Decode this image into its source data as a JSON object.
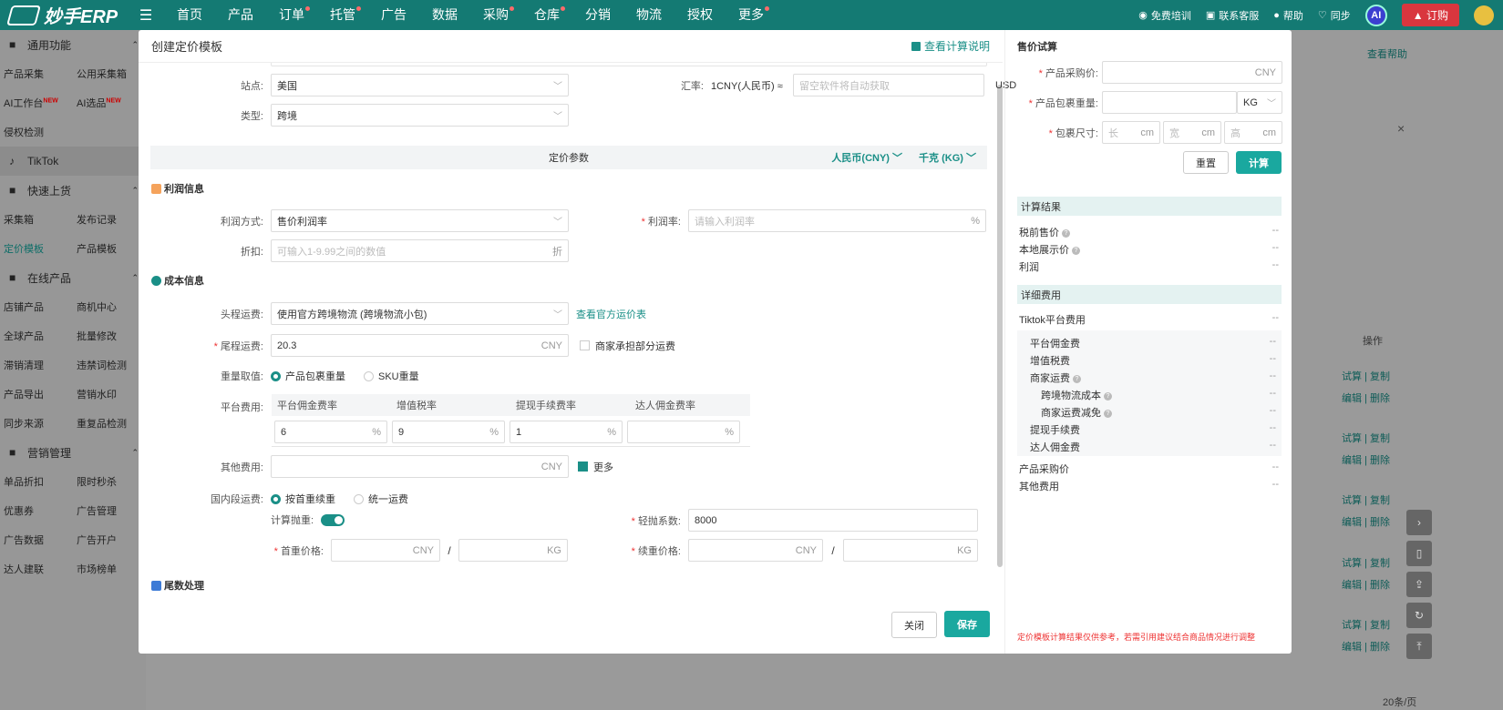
{
  "app": {
    "logo_text": "妙手ERP"
  },
  "nav": [
    "首页",
    "产品",
    "订单",
    "托管",
    "广告",
    "数据",
    "采购",
    "仓库",
    "分销",
    "物流",
    "授权",
    "更多"
  ],
  "nav_dots": [
    false,
    false,
    true,
    true,
    false,
    false,
    true,
    true,
    false,
    false,
    false,
    true
  ],
  "top_right": {
    "training": "免费培训",
    "service": "联系客服",
    "help": "帮助",
    "sync": "同步",
    "ai": "AI",
    "order": "订购"
  },
  "sidebar": {
    "sec1": "通用功能",
    "rows1": [
      [
        "产品采集",
        "公用采集箱"
      ],
      [
        "AI工作台",
        "AI选品"
      ],
      [
        "侵权检测",
        ""
      ]
    ],
    "new_tag": "NEW",
    "tiktok": "TikTok",
    "sec2": "快速上货",
    "rows2": [
      [
        "采集箱",
        "发布记录"
      ],
      [
        "定价模板",
        "产品模板"
      ]
    ],
    "sec3": "在线产品",
    "rows3": [
      [
        "店铺产品",
        "商机中心"
      ],
      [
        "全球产品",
        "批量修改"
      ],
      [
        "滞销清理",
        "违禁词检测"
      ],
      [
        "产品导出",
        "营销水印"
      ],
      [
        "同步来源",
        "重复品检测"
      ]
    ],
    "sec4": "营销管理",
    "rows4": [
      [
        "单品折扣",
        "限时秒杀"
      ],
      [
        "优惠券",
        "广告管理"
      ],
      [
        "广告数据",
        "广告开户"
      ],
      [
        "达人建联",
        "市场榜单"
      ]
    ]
  },
  "bg": {
    "help": "查看帮助",
    "op": "操作",
    "a1": "试算",
    "a2": "复制",
    "b1": "编辑",
    "b2": "删除",
    "pager": "20条/页"
  },
  "modal": {
    "title": "创建定价模板",
    "calc_link": "查看计算说明",
    "site_label": "站点:",
    "site_value": "美国",
    "type_label": "类型:",
    "type_value": "跨境",
    "rate_label": "汇率:",
    "rate_text": "1CNY(人民币) ≈",
    "rate_placeholder": "留空软件将自动获取",
    "rate_unit": "USD",
    "params": "定价参数",
    "currency": "人民币(CNY)",
    "weight_unit": "千克 (KG)",
    "profit_title": "利润信息",
    "profit_method_label": "利润方式:",
    "profit_method_value": "售价利润率",
    "profit_rate_label": "利润率:",
    "profit_rate_placeholder": "请输入利润率",
    "pct": "%",
    "discount_label": "折扣:",
    "discount_placeholder": "可输入1-9.99之间的数值",
    "discount_unit": "折",
    "cost_title": "成本信息",
    "first_leg_label": "头程运费:",
    "first_leg_value": "使用官方跨境物流 (跨境物流小包)",
    "first_leg_link": "查看官方运价表",
    "last_leg_label": "尾程运费:",
    "last_leg_value": "20.3",
    "cny": "CNY",
    "merchant_share": "商家承担部分运费",
    "weight_label": "重量取值:",
    "weight_opt1": "产品包裹重量",
    "weight_opt2": "SKU重量",
    "platform_label": "平台费用:",
    "fee_headers": [
      "平台佣金费率",
      "增值税率",
      "提现手续费率",
      "达人佣金费率"
    ],
    "fee_values": [
      "6",
      "9",
      "1",
      ""
    ],
    "other_label": "其他费用:",
    "more": "更多",
    "domestic_label": "国内段运费:",
    "dom_opt1": "按首重续重",
    "dom_opt2": "统一运费",
    "vol_label": "计算抛重:",
    "light_label": "轻抛系数:",
    "light_value": "8000",
    "first_price_label": "首重价格:",
    "cont_price_label": "续重价格:",
    "kg": "KG",
    "slash": "/",
    "tail_title": "尾数处理",
    "close": "关闭",
    "save": "保存"
  },
  "trial": {
    "title": "售价试算",
    "purchase_label": "产品采购价:",
    "pkg_weight_label": "产品包裹重量:",
    "size_label": "包裹尺寸:",
    "len": "长",
    "wid": "宽",
    "hei": "高",
    "cm": "cm",
    "reset": "重置",
    "calc": "计算",
    "result_head": "计算结果",
    "results": [
      "税前售价",
      "本地展示价",
      "利润"
    ],
    "detail_head": "详细费用",
    "tiktok_fee": "Tiktok平台费用",
    "fee_items": [
      "平台佣金费",
      "增值税费",
      "商家运费",
      "跨境物流成本",
      "商家运费减免",
      "提现手续费",
      "达人佣金费"
    ],
    "tail_items": [
      "产品采购价",
      "其他费用"
    ],
    "dash": "--",
    "note": "定价模板计算结果仅供参考，若需引用建议结合商品情况进行调整"
  },
  "colors": {
    "primary": "#1a8f87",
    "topbar": "#147a73",
    "required": "#ee3333"
  }
}
